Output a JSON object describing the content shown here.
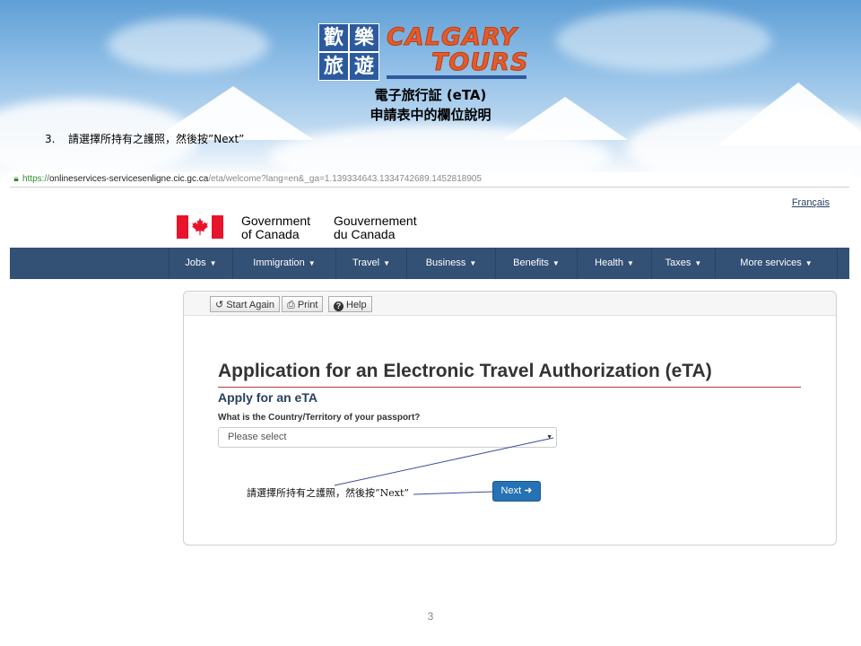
{
  "slide": {
    "logo_chars": [
      "歡",
      "樂",
      "旅",
      "遊"
    ],
    "logo_word_1": "CALGARY",
    "logo_word_2": "TOURS",
    "title_line_1": "電子旅行証 (eTA)",
    "title_line_2": "申請表中的欄位說明",
    "step_number": "3.",
    "step_text": "請選擇所持有之護照，然後按”Next”",
    "page_number": "3"
  },
  "browser": {
    "url_scheme": "https://",
    "url_host": "onlineservices-servicesenligne.cic.gc.ca",
    "url_path": "/eta/welcome?lang=en&_ga=1.139334643.1334742689.1452818905"
  },
  "site": {
    "language_link": "Français",
    "gov_en_line1": "Government",
    "gov_en_line2": "of Canada",
    "gov_fr_line1": "Gouvernement",
    "gov_fr_line2": "du Canada",
    "nav": [
      {
        "label": "Jobs"
      },
      {
        "label": "Immigration"
      },
      {
        "label": "Travel"
      },
      {
        "label": "Business"
      },
      {
        "label": "Benefits"
      },
      {
        "label": "Health"
      },
      {
        "label": "Taxes"
      },
      {
        "label": "More services"
      }
    ]
  },
  "toolbar": {
    "start_again": "Start Again",
    "print": "Print",
    "help": "Help"
  },
  "form": {
    "title": "Application for an Electronic Travel Authorization (eTA)",
    "subtitle": "Apply for an eTA",
    "question": "What is the Country/Territory of your passport?",
    "select_placeholder": "Please select",
    "next_label": "Next"
  },
  "annotation": {
    "text": "請選擇所持有之護照，然後按“Next”"
  },
  "colors": {
    "nav_bg": "#335075",
    "next_button": "#2572b4",
    "flag_red": "#e8142c",
    "title_rule": "#af3c43"
  }
}
